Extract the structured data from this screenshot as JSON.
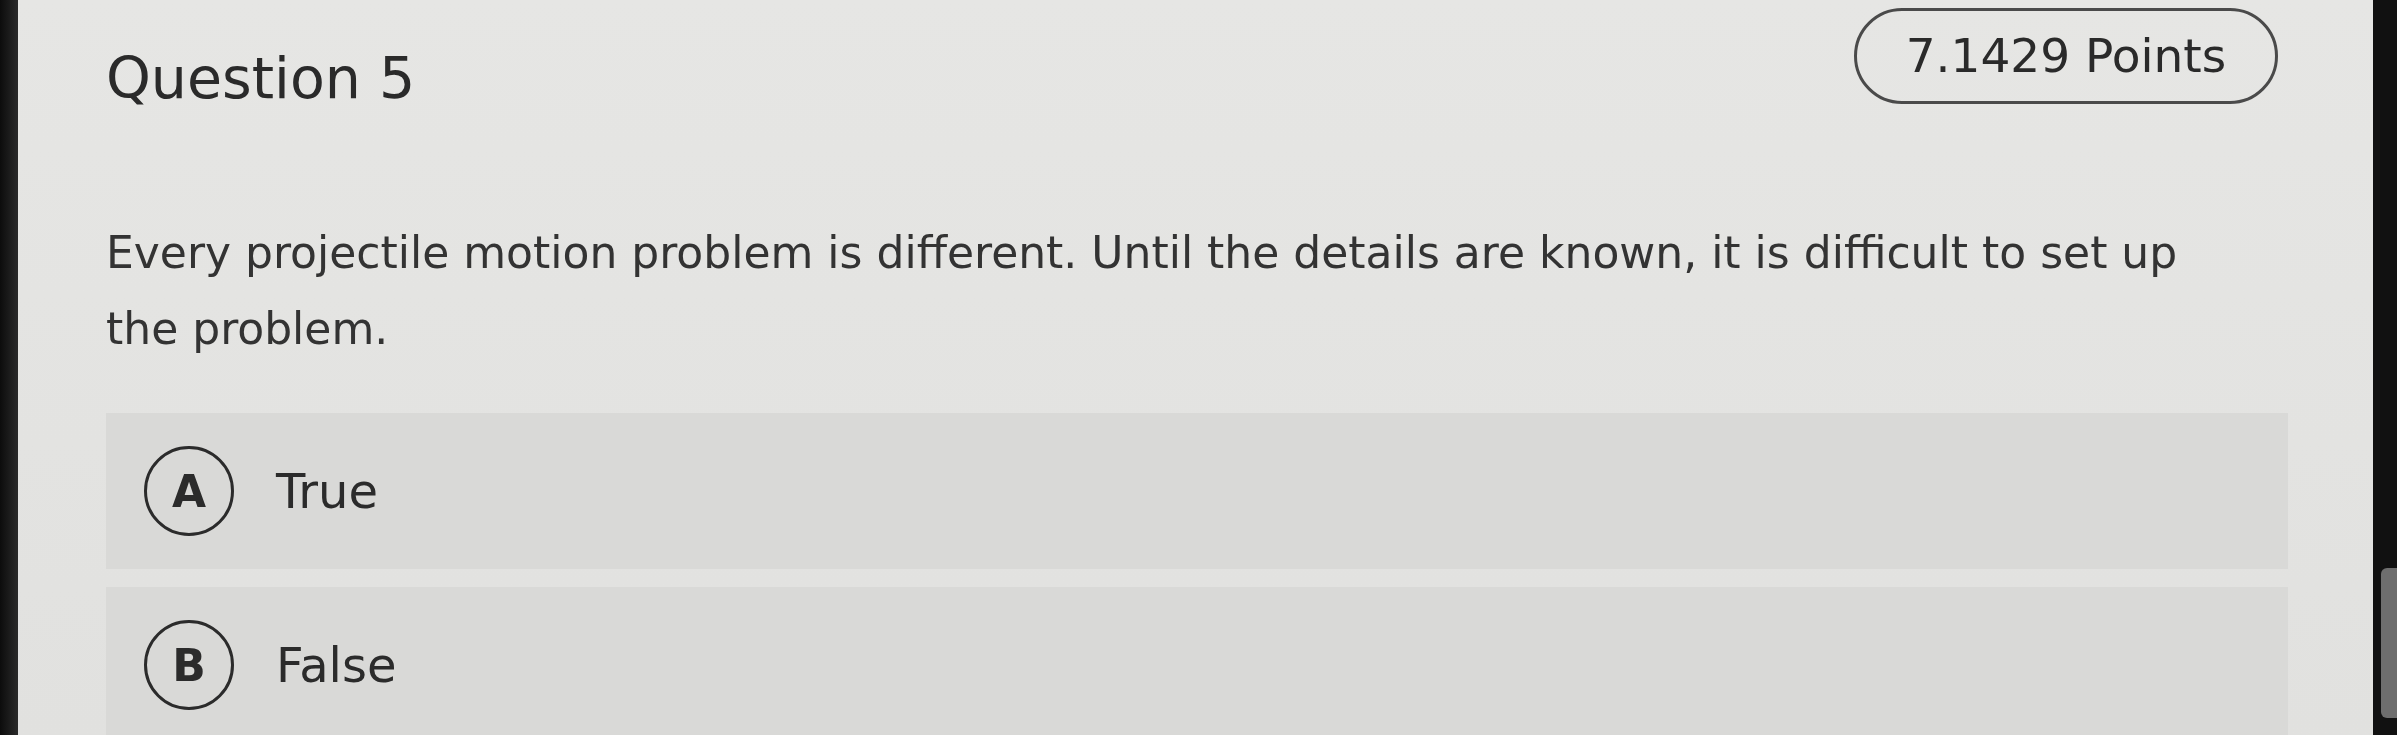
{
  "question": {
    "title": "Question 5",
    "points": "7.1429 Points",
    "text": "Every projectile motion problem is different. Until the details are known, it is difficult to set up the problem."
  },
  "options": [
    {
      "letter": "A",
      "label": "True",
      "selected": false
    },
    {
      "letter": "B",
      "label": "False",
      "selected": false
    }
  ]
}
